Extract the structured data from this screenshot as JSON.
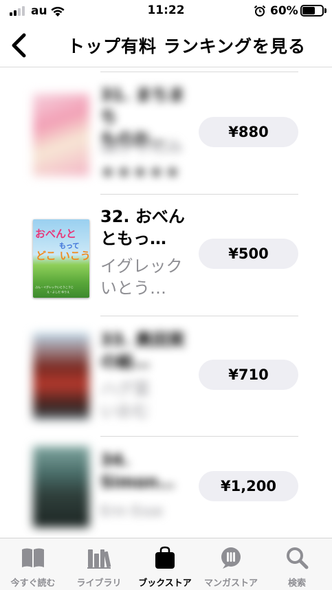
{
  "status": {
    "carrier": "au",
    "time": "11:22",
    "battery": "60%"
  },
  "nav": {
    "title": "トップ有料 ランキングを見る"
  },
  "books": [
    {
      "title_line1": "31. まちまち",
      "title_line2": "ものお…",
      "author_line1": "ほげりんみ",
      "rating": "★★★★★",
      "price": "¥880",
      "blurred": true
    },
    {
      "title_line1": "32. おべん",
      "title_line2": "ともっ…",
      "author_line1": "イグレック",
      "author_line2": "いとう…",
      "price": "¥500",
      "blurred": false
    },
    {
      "title_line1": "33. 奥田実",
      "title_line2": "の絵…",
      "author_line1": "ハグ菜",
      "author_line2": "いおむ",
      "price": "¥710",
      "blurred": true
    },
    {
      "title_line1": "34.",
      "title_line2": "Simon…",
      "author_line1": "Erin Esse",
      "price": "¥1,200",
      "blurred": true
    }
  ],
  "cover_art": {
    "title_line1": "おべんと",
    "title_line2": "もって",
    "title_line3": "どこ いこう",
    "caption": "ぶん・イグレックいとうこうじ",
    "caption2": "え・よしだ ゆりえ"
  },
  "tabs": [
    {
      "label": "今すぐ読む",
      "icon": "book-open-icon"
    },
    {
      "label": "ライブラリ",
      "icon": "library-icon"
    },
    {
      "label": "ブックストア",
      "icon": "shopping-bag-icon",
      "active": true
    },
    {
      "label": "マンガストア",
      "icon": "manga-store-icon"
    },
    {
      "label": "検索",
      "icon": "search-icon"
    }
  ]
}
